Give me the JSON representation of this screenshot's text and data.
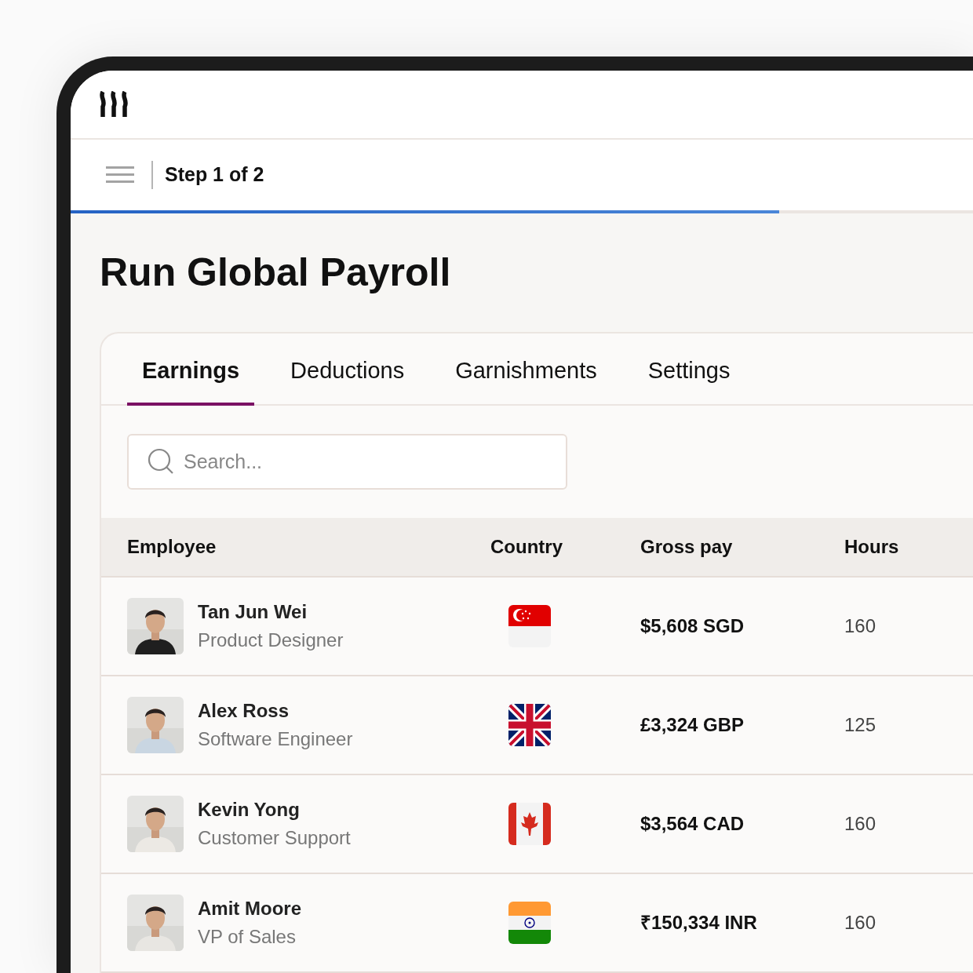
{
  "header": {
    "step": "Step 1 of 2",
    "progress": {
      "level": 0.785
    }
  },
  "title": "Run Global Payroll",
  "tabs": [
    {
      "label": "Earnings",
      "selected": true
    },
    {
      "label": "Deductions",
      "selected": false
    },
    {
      "label": "Garnishments",
      "selected": false
    },
    {
      "label": "Settings",
      "selected": false
    }
  ],
  "search": {
    "placeholder": "Search..."
  },
  "table": {
    "columns": [
      "Employee",
      "Country",
      "Gross pay",
      "Hours"
    ],
    "rows": [
      {
        "name": "Tan Jun Wei",
        "role": "Product Designer",
        "kind": "sg",
        "gross_pay": "$5,608 SGD",
        "hours": "160"
      },
      {
        "name": "Alex Ross",
        "role": "Software Engineer",
        "kind": "gb",
        "gross_pay": "£3,324 GBP",
        "hours": "125"
      },
      {
        "name": "Kevin Yong",
        "role": "Customer Support",
        "kind": "ca",
        "gross_pay": "$3,564 CAD",
        "hours": "160"
      },
      {
        "name": "Amit Moore",
        "role": "VP of Sales",
        "kind": "in",
        "gross_pay": "₹150,334 INR",
        "hours": "160"
      }
    ]
  }
}
